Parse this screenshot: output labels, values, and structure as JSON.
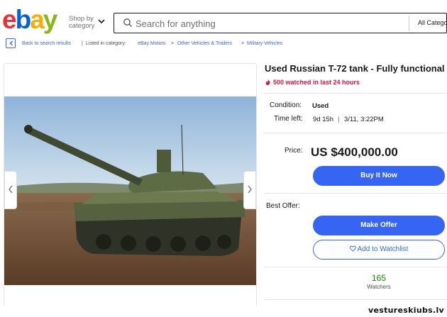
{
  "header": {
    "logo": {
      "letters": [
        "e",
        "b",
        "a",
        "y"
      ],
      "colors": [
        "#e53238",
        "#0064d2",
        "#f5af02",
        "#86b817"
      ]
    },
    "shop_by_line1": "Shop by",
    "shop_by_line2": "category",
    "search_placeholder": "Search for anything",
    "all_categories": "All Catego"
  },
  "breadcrumb": {
    "back": "Back to search results",
    "listed_in": "Listed in category:",
    "items": [
      "eBay Motors",
      "Other Vehicles & Trailers",
      "Military Vehicles"
    ],
    "separators": [
      ">",
      ">"
    ]
  },
  "listing": {
    "title": "Used Russian T-72 tank - Fully functional",
    "watched": "500 watched in last 24 hours",
    "condition_label": "Condition:",
    "condition_value": "Used",
    "time_left_label": "Time left:",
    "time_left_value": "9d 15h",
    "time_left_sep": "|",
    "time_left_end": "3/11, 3:22PM",
    "price_label": "Price:",
    "price": "US $400,000.00",
    "buy_now": "Buy It Now",
    "best_offer_label": "Best Offer:",
    "make_offer": "Make Offer",
    "add_watchlist": "Add to Watchlist",
    "watchers_count": "165",
    "watchers_label": "Watchers"
  },
  "watermark": "vestureskiubs.lv",
  "colors": {
    "accent": "#3665f3",
    "alert": "#e0103a",
    "watchers_green": "#108a00"
  }
}
